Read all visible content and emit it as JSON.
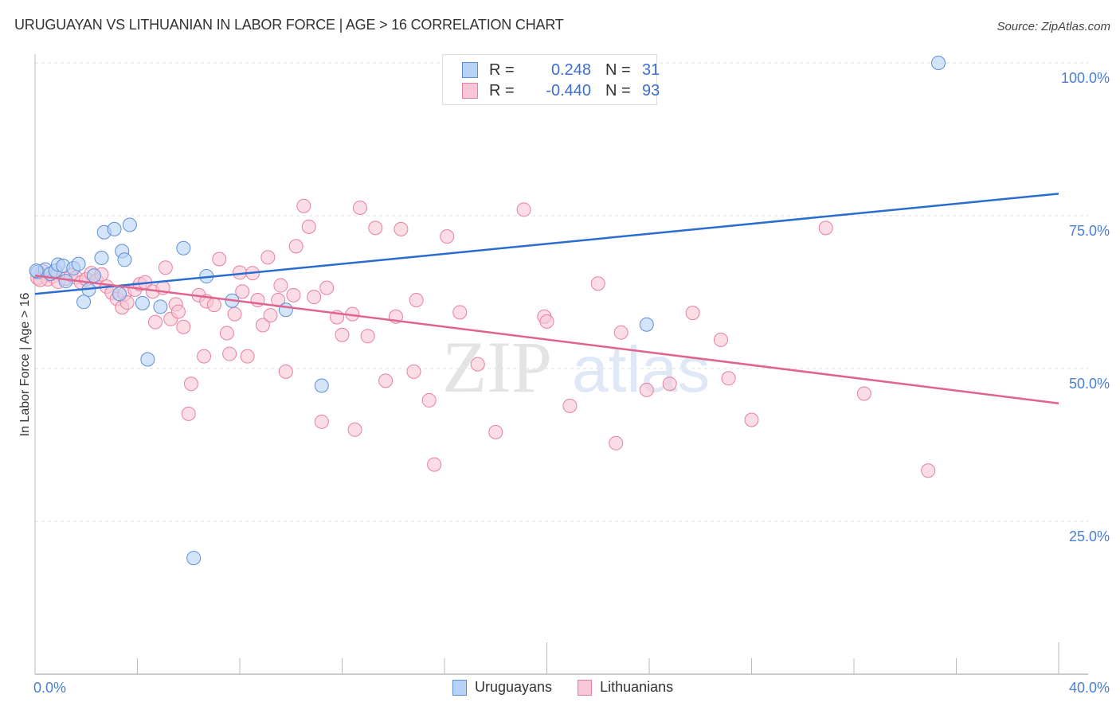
{
  "title": "URUGUAYAN VS LITHUANIAN IN LABOR FORCE | AGE > 16 CORRELATION CHART",
  "source": "Source: ZipAtlas.com",
  "watermark": {
    "zip": "ZIP",
    "atlas": "atlas"
  },
  "legend": {
    "rows": [
      {
        "r_label": "R =",
        "r_value": "0.248",
        "n_label": "N =",
        "n_value": "31"
      },
      {
        "r_label": "R =",
        "r_value": "-0.440",
        "n_label": "N =",
        "n_value": "93"
      }
    ]
  },
  "bottom_legend": [
    "Uruguayans",
    "Lithuanians"
  ],
  "colors": {
    "uruguayans_fill": "#b8d2f5",
    "uruguayans_stroke": "#5b8fd9",
    "uruguayans_line": "#2a6dd0",
    "lithuanians_fill": "#f9c6d5",
    "lithuanians_stroke": "#e87fa0",
    "lithuanians_line": "#e06390",
    "tick_label": "#4a7fcf"
  },
  "chart_data": {
    "type": "scatter",
    "title": "URUGUAYAN VS LITHUANIAN IN LABOR FORCE | AGE > 16 CORRELATION CHART",
    "xlabel": "",
    "ylabel": "In Labor Force | Age > 16",
    "xlim": [
      0,
      40
    ],
    "ylim": [
      0,
      100
    ],
    "x_tick_labels": [
      {
        "value": 0,
        "label": "0.0%"
      },
      {
        "value": 40,
        "label": "40.0%"
      }
    ],
    "y_tick_labels": [
      {
        "value": 25,
        "label": "25.0%"
      },
      {
        "value": 50,
        "label": "50.0%"
      },
      {
        "value": 75,
        "label": "75.0%"
      },
      {
        "value": 100,
        "label": "100.0%"
      }
    ],
    "grid": true,
    "legend_position": "top-center",
    "series": [
      {
        "name": "Uruguayans",
        "R": 0.248,
        "N": 31,
        "trend": [
          [
            0,
            62.2
          ],
          [
            40,
            78.6
          ]
        ],
        "points": [
          [
            0.1,
            65.8
          ],
          [
            0.4,
            66.2
          ],
          [
            0.6,
            65.5
          ],
          [
            0.8,
            66.0
          ],
          [
            0.9,
            67.0
          ],
          [
            1.1,
            66.8
          ],
          [
            1.2,
            64.3
          ],
          [
            1.5,
            66.4
          ],
          [
            1.7,
            67.1
          ],
          [
            1.9,
            60.9
          ],
          [
            2.1,
            62.9
          ],
          [
            2.3,
            65.2
          ],
          [
            2.6,
            68.1
          ],
          [
            2.7,
            72.3
          ],
          [
            3.1,
            72.8
          ],
          [
            3.3,
            62.2
          ],
          [
            3.4,
            69.2
          ],
          [
            3.5,
            67.8
          ],
          [
            3.7,
            73.5
          ],
          [
            4.2,
            60.7
          ],
          [
            4.4,
            51.5
          ],
          [
            4.9,
            60.1
          ],
          [
            5.8,
            69.7
          ],
          [
            6.2,
            19.0
          ],
          [
            6.7,
            65.1
          ],
          [
            7.7,
            61.1
          ],
          [
            9.8,
            59.6
          ],
          [
            11.2,
            47.2
          ],
          [
            23.9,
            57.2
          ],
          [
            35.3,
            100.0
          ],
          [
            0.05,
            66.0
          ]
        ]
      },
      {
        "name": "Lithuanians",
        "R": -0.44,
        "N": 93,
        "trend": [
          [
            0,
            65.2
          ],
          [
            40,
            44.3
          ]
        ],
        "points": [
          [
            0.1,
            64.8
          ],
          [
            0.3,
            65.9
          ],
          [
            0.5,
            64.6
          ],
          [
            0.7,
            65.1
          ],
          [
            0.9,
            64.2
          ],
          [
            1.2,
            64.7
          ],
          [
            1.4,
            65.3
          ],
          [
            1.6,
            64.9
          ],
          [
            1.8,
            64.1
          ],
          [
            2.0,
            64.6
          ],
          [
            2.2,
            65.6
          ],
          [
            2.4,
            64.4
          ],
          [
            2.6,
            65.4
          ],
          [
            2.8,
            63.4
          ],
          [
            3.0,
            62.4
          ],
          [
            3.2,
            61.4
          ],
          [
            3.4,
            60.0
          ],
          [
            3.5,
            62.2
          ],
          [
            3.6,
            60.8
          ],
          [
            3.9,
            62.9
          ],
          [
            4.1,
            63.8
          ],
          [
            4.3,
            64.1
          ],
          [
            4.6,
            62.6
          ],
          [
            4.7,
            57.6
          ],
          [
            5.0,
            63.2
          ],
          [
            5.1,
            66.5
          ],
          [
            5.3,
            58.1
          ],
          [
            5.5,
            60.5
          ],
          [
            5.6,
            59.3
          ],
          [
            5.8,
            56.8
          ],
          [
            6.0,
            42.6
          ],
          [
            6.1,
            47.5
          ],
          [
            6.4,
            62.0
          ],
          [
            6.6,
            52.0
          ],
          [
            6.7,
            61.0
          ],
          [
            7.0,
            60.4
          ],
          [
            7.2,
            67.9
          ],
          [
            7.5,
            55.8
          ],
          [
            7.6,
            52.4
          ],
          [
            7.8,
            58.9
          ],
          [
            8.0,
            65.7
          ],
          [
            8.1,
            62.6
          ],
          [
            8.3,
            52.0
          ],
          [
            8.5,
            65.6
          ],
          [
            8.7,
            61.2
          ],
          [
            8.9,
            57.1
          ],
          [
            9.1,
            68.2
          ],
          [
            9.2,
            58.7
          ],
          [
            9.5,
            61.2
          ],
          [
            9.6,
            63.6
          ],
          [
            9.8,
            49.5
          ],
          [
            10.1,
            62.0
          ],
          [
            10.2,
            70.0
          ],
          [
            10.5,
            76.6
          ],
          [
            10.7,
            73.2
          ],
          [
            10.9,
            61.7
          ],
          [
            11.2,
            41.3
          ],
          [
            11.4,
            63.2
          ],
          [
            11.8,
            58.4
          ],
          [
            12.0,
            55.5
          ],
          [
            12.4,
            58.9
          ],
          [
            12.5,
            40.0
          ],
          [
            12.7,
            76.3
          ],
          [
            13.0,
            55.3
          ],
          [
            13.3,
            73.0
          ],
          [
            13.7,
            48.0
          ],
          [
            14.1,
            58.5
          ],
          [
            14.3,
            72.8
          ],
          [
            14.8,
            49.5
          ],
          [
            14.9,
            61.2
          ],
          [
            15.4,
            44.8
          ],
          [
            15.6,
            34.3
          ],
          [
            16.1,
            71.6
          ],
          [
            16.6,
            59.2
          ],
          [
            17.3,
            50.7
          ],
          [
            18.0,
            39.6
          ],
          [
            19.1,
            76.0
          ],
          [
            19.9,
            58.5
          ],
          [
            20.0,
            57.7
          ],
          [
            20.9,
            43.9
          ],
          [
            22.0,
            63.9
          ],
          [
            22.7,
            37.8
          ],
          [
            22.9,
            55.9
          ],
          [
            23.9,
            46.5
          ],
          [
            24.8,
            47.5
          ],
          [
            25.7,
            59.1
          ],
          [
            26.8,
            54.7
          ],
          [
            27.1,
            48.4
          ],
          [
            28.0,
            41.6
          ],
          [
            30.9,
            73.0
          ],
          [
            32.4,
            45.9
          ],
          [
            34.9,
            33.3
          ],
          [
            0.2,
            64.5
          ]
        ]
      }
    ]
  }
}
